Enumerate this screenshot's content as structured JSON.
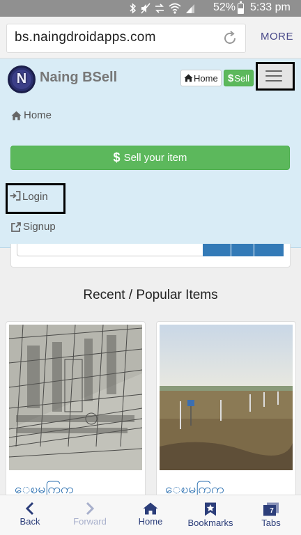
{
  "status": {
    "battery": "52%",
    "time": "5:33 pm",
    "battery_level": 0.52
  },
  "browser": {
    "url": "bs.naingdroidapps.com",
    "more_label": "MORE"
  },
  "header": {
    "logo_letter": "N",
    "brand": "Naing BSell",
    "home_label": "Home",
    "sell_label": "Sell"
  },
  "menu": {
    "home_label": "Home",
    "sell_item_label": "Sell your item",
    "login_label": "Login",
    "signup_label": "Signup"
  },
  "section": {
    "title": "Recent / Popular Items"
  },
  "items": [
    {
      "title": "ေၿမကြက္",
      "image": "land-plot-map-photo"
    },
    {
      "title": "ေၿမကြက္",
      "image": "empty-land-field-photo"
    }
  ],
  "bottom_nav": {
    "back_label": "Back",
    "forward_label": "Forward",
    "home_label": "Home",
    "bookmarks_label": "Bookmarks",
    "tabs_label": "Tabs",
    "tabs_count": "7"
  },
  "colors": {
    "status_bar": "#909090",
    "menu_panel": "#d9ecf6",
    "success_green": "#5cb85c",
    "primary_blue": "#337ab7",
    "nav_text": "#2c3e7a"
  }
}
